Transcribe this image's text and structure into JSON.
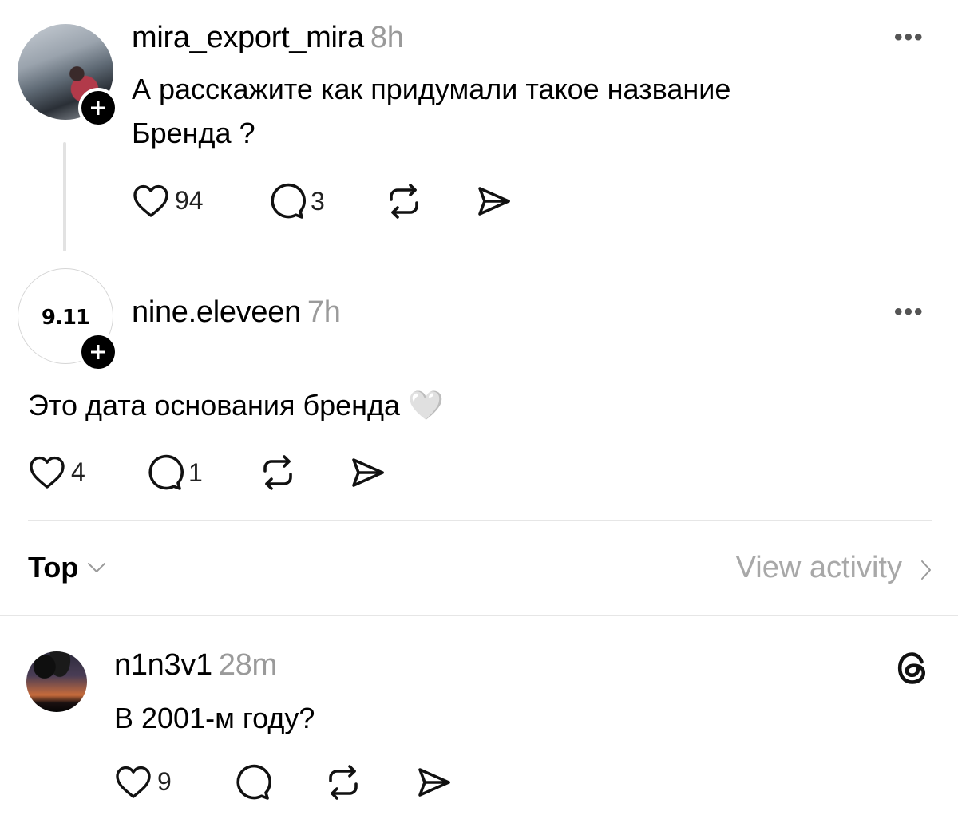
{
  "comments": [
    {
      "username": "mira_export_mira",
      "time": "8h",
      "text_line1": "А расскажите как придумали такое название",
      "text_line2": "Бренда ?",
      "likes": "94",
      "replies": "3",
      "more": "•••"
    },
    {
      "username": "nine.eleveen",
      "time": "7h",
      "avatar_logo": "9.11",
      "text": "Это дата основания бренда 🤍",
      "likes": "4",
      "replies": "1",
      "more": "•••"
    },
    {
      "username": "n1n3v1",
      "time": "28m",
      "text": "В 2001-м году?",
      "likes": "9",
      "replies": ""
    }
  ],
  "sort": {
    "label": "Top",
    "view_activity": "View activity"
  },
  "icons": [
    "heart-icon",
    "comment-icon",
    "repost-icon",
    "share-icon",
    "threads-logo-icon",
    "chevron-down-icon",
    "chevron-right-icon"
  ]
}
